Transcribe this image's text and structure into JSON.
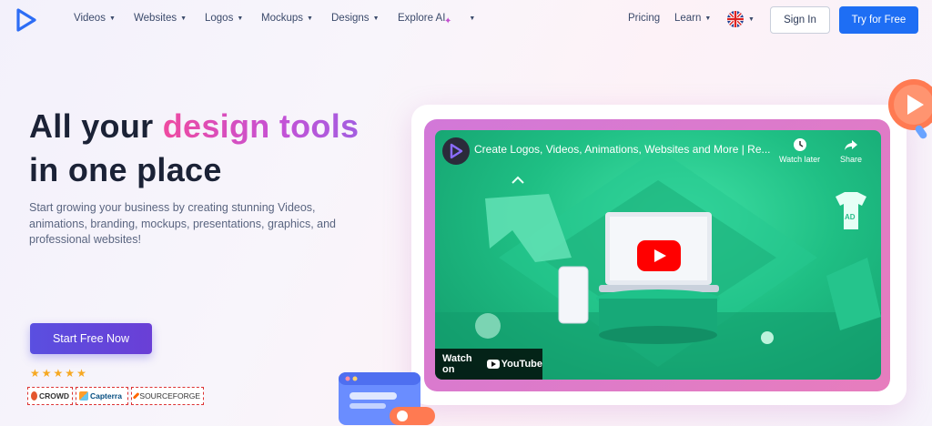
{
  "nav": {
    "items": [
      {
        "label": "Videos"
      },
      {
        "label": "Websites"
      },
      {
        "label": "Logos"
      },
      {
        "label": "Mockups"
      },
      {
        "label": "Designs"
      },
      {
        "label": "Explore AI"
      }
    ],
    "pricing": "Pricing",
    "learn": "Learn",
    "sign_in": "Sign In",
    "try_free": "Try for Free"
  },
  "hero": {
    "headline_part1": "All your ",
    "headline_accent": "design tools",
    "headline_part2": "in one place",
    "subtext": "Start growing your business by creating stunning Videos, animations, branding, mockups, presentations, graphics, and professional websites!",
    "cta": "Start Free Now",
    "rating_stars": 5,
    "badges": [
      "CROWD",
      "Capterra",
      "SOURCEFORGE"
    ]
  },
  "video": {
    "title": "Create Logos, Videos, Animations, Websites and More | Re...",
    "watch_later": "Watch later",
    "share": "Share",
    "watch_on": "Watch on",
    "youtube": "YouTube",
    "tshirt_text": "AD"
  },
  "colors": {
    "primary_blue": "#1e6ef4",
    "cta_purple": "#5a4fe0",
    "accent_pink": "#ef4aa0",
    "accent_violet": "#a35ee0",
    "video_green": "#1fbf84",
    "youtube_red": "#ff0000"
  }
}
